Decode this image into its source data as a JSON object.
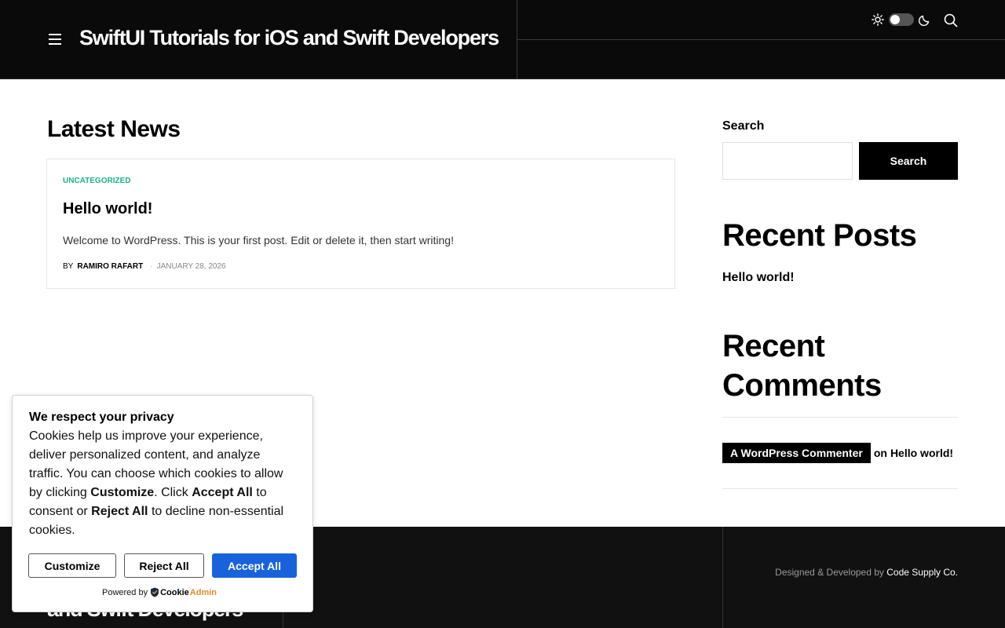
{
  "header": {
    "site_title": "SwiftUI Tutorials for iOS and Swift Developers"
  },
  "main": {
    "heading": "Latest News",
    "posts": [
      {
        "category": "UNCATEGORIZED",
        "title": "Hello world!",
        "excerpt": "Welcome to WordPress. This is your first post. Edit or delete it, then start writing!",
        "by_label": "BY",
        "author": "RAMIRO RAFART",
        "separator": "·",
        "date": "JANUARY 28, 2026"
      }
    ]
  },
  "sidebar": {
    "search_label": "Search",
    "search_placeholder": "",
    "search_button": "Search",
    "recent_posts_title": "Recent Posts",
    "recent_posts": [
      {
        "title": "Hello world!"
      }
    ],
    "recent_comments_title": "Recent Comments",
    "recent_comments": [
      {
        "author": "A WordPress Commenter",
        "on_label": "on",
        "post": "Hello world!"
      }
    ]
  },
  "footer": {
    "site_title_visible": "and Swift Developers",
    "credit_prefix": "Designed & Developed by",
    "credit_link": "Code Supply Co."
  },
  "cookie_banner": {
    "title": "We respect your privacy",
    "text_part1": "Cookies help us improve your experience, deliver personalized content, and analyze traffic. You can choose which cookies to allow by clicking",
    "text_bold1": "Customize",
    "text_part2": ". Click",
    "text_bold2": "Accept All",
    "text_part3": "to consent or",
    "text_bold3": "Reject All",
    "text_part4": "to decline non-essential cookies.",
    "customize_button": "Customize",
    "reject_button": "Reject All",
    "accept_button": "Accept All",
    "powered_by": "Powered by",
    "brand_cookie": "Cookie",
    "brand_admin": "Admin"
  },
  "colors": {
    "header_bg": "#0a0a0a",
    "category": "#19b28e",
    "accept_button": "#1863dc",
    "brand_admin": "#e08c2b"
  },
  "icons": {
    "menu": "hamburger-icon",
    "theme_light": "sun-icon",
    "theme_dark": "moon-icon",
    "search": "search-icon",
    "brand": "cookieadmin-shield-icon"
  }
}
